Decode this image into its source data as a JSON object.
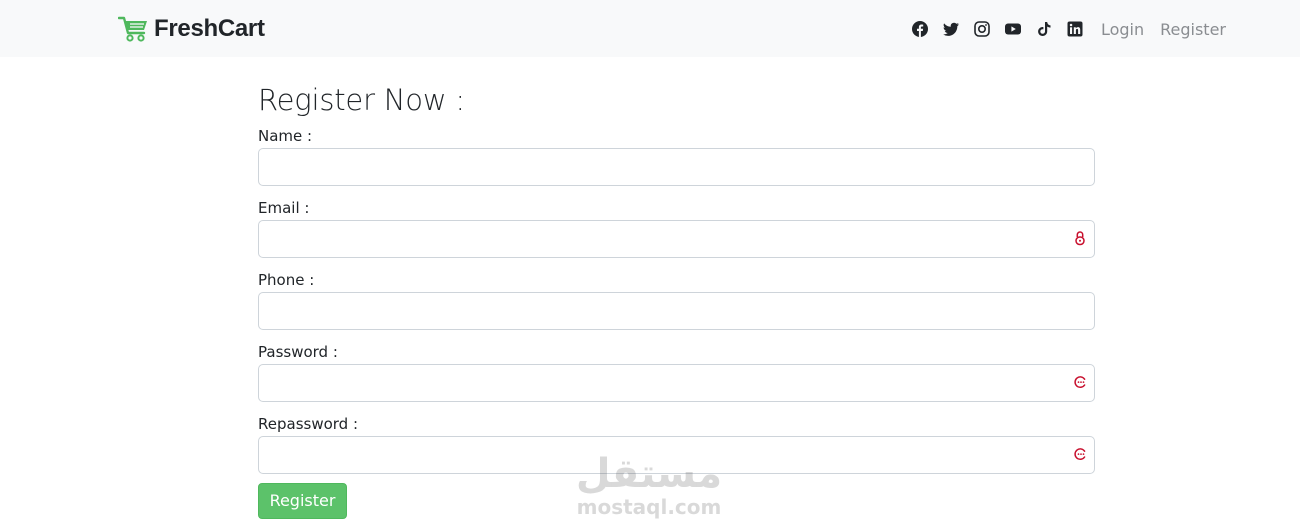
{
  "navbar": {
    "brand": "FreshCart",
    "links": {
      "login": "Login",
      "register": "Register"
    }
  },
  "form": {
    "title": "Register Now :",
    "fields": {
      "name": {
        "label": "Name :",
        "value": ""
      },
      "email": {
        "label": "Email :",
        "value": ""
      },
      "phone": {
        "label": "Phone :",
        "value": ""
      },
      "password": {
        "label": "Password :",
        "value": ""
      },
      "repassword": {
        "label": "Repassword :",
        "value": ""
      }
    },
    "submit_label": "Register"
  },
  "watermark": {
    "script": "مستقل",
    "url": "mostaql.com"
  },
  "colors": {
    "brand_green": "#4fb85d",
    "button_green": "#5cc26a",
    "icon_red": "#c8102e",
    "navbar_bg": "#f8f9fa"
  }
}
